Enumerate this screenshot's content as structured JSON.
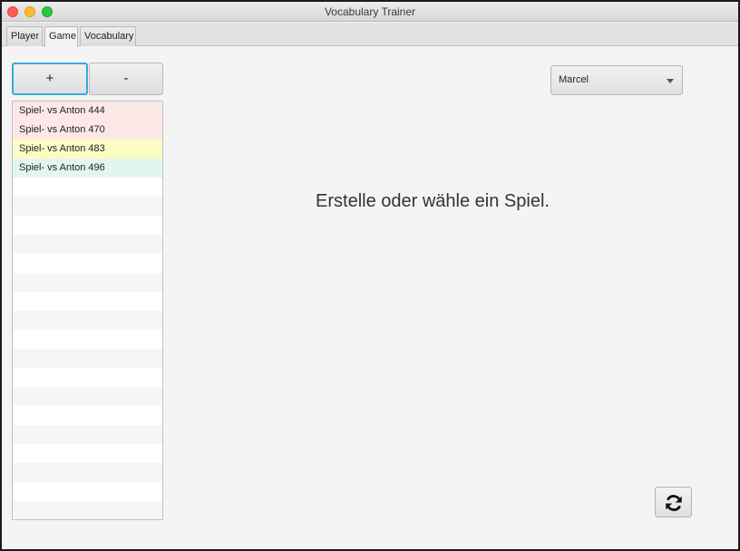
{
  "window": {
    "title": "Vocabulary Trainer"
  },
  "tabs": [
    {
      "label": "Player",
      "active": false
    },
    {
      "label": "Game",
      "active": true
    },
    {
      "label": "Vocabulary",
      "active": false
    }
  ],
  "buttons": {
    "add_label": "+",
    "remove_label": "-"
  },
  "games": [
    {
      "label": "Spiel- vs Anton 444",
      "color": "#fde8e8"
    },
    {
      "label": "Spiel- vs Anton 470",
      "color": "#fde8e8"
    },
    {
      "label": "Spiel- vs Anton 483",
      "color": "#fafcc4"
    },
    {
      "label": "Spiel- vs Anton 496",
      "color": "#e2f6f1"
    }
  ],
  "player_select": {
    "value": "Marcel"
  },
  "main": {
    "message": "Erstelle oder wähle ein Spiel."
  },
  "icons": {
    "refresh": "refresh-icon"
  },
  "colors": {
    "focus_border": "#3aa7df"
  }
}
